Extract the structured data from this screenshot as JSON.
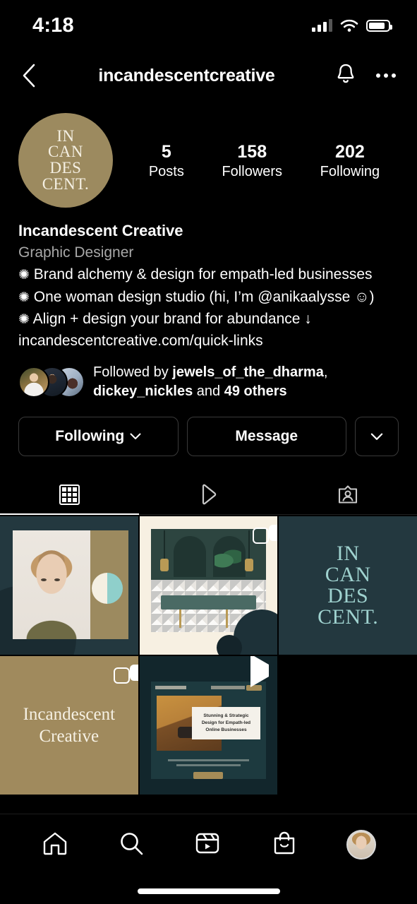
{
  "status_bar": {
    "time": "4:18",
    "signal_icon": "cellular-signal-icon",
    "wifi_icon": "wifi-icon",
    "battery_icon": "battery-icon"
  },
  "header": {
    "back_icon": "chevron-left-icon",
    "title": "incandescentcreative",
    "notify_icon": "bell-icon",
    "more_icon": "ellipsis-icon"
  },
  "profile": {
    "avatar": {
      "name": "profile-avatar",
      "logo_lines": [
        "IN",
        "CAN",
        "DES",
        "CENT."
      ],
      "bg_color": "#9c8a5f",
      "text_color": "#f4efe2"
    },
    "stats": [
      {
        "num": "5",
        "label": "Posts"
      },
      {
        "num": "158",
        "label": "Followers"
      },
      {
        "num": "202",
        "label": "Following"
      }
    ],
    "display_name": "Incandescent Creative",
    "category": "Graphic Designer",
    "bio_lines": [
      {
        "bullet": "✺",
        "text": " Brand alchemy & design for empath-led businesses"
      },
      {
        "bullet": "✺",
        "text": " One woman design studio (hi, I’m @anikaalysse ☺)"
      },
      {
        "bullet": "✺",
        "text": " Align + design your brand for abundance ↓"
      }
    ],
    "link": "incandescentcreative.com/quick-links",
    "followed_by": {
      "prefix": "Followed by ",
      "user1": "jewels_of_the_dharma",
      "separator": ", ",
      "user2": "dickey_nickles",
      "middle": " and ",
      "others": "49 others"
    }
  },
  "actions": {
    "following_label": "Following",
    "message_label": "Message",
    "more_icon": "chevron-down-icon",
    "following_chevron_icon": "chevron-down-icon"
  },
  "tabs": [
    {
      "name": "grid",
      "icon": "grid-icon",
      "active": true
    },
    {
      "name": "reels",
      "icon": "play-triangle-icon",
      "active": false
    },
    {
      "name": "tagged",
      "icon": "tagged-person-icon",
      "active": false
    }
  ],
  "grid": {
    "posts": [
      {
        "name": "post-portrait-headshot",
        "badge": "none",
        "alt": "Portrait headshot on teal background with gold band"
      },
      {
        "name": "post-bathroom-interior",
        "badge": "carousel",
        "alt": "Bathroom interior with arched mirrors and geometric tile"
      },
      {
        "name": "post-incandescent-logo",
        "badge": "none",
        "alt": "Incandescent logo card",
        "logo_lines": [
          "IN",
          "CAN",
          "DES",
          "CENT."
        ]
      },
      {
        "name": "post-incandescent-wordmark",
        "badge": "carousel",
        "alt": "Gold wordmark card",
        "wordmark_lines": [
          "Incandescent",
          "Creative"
        ]
      },
      {
        "name": "post-website-reel",
        "badge": "reel",
        "alt": "Reel showing website design",
        "headline": "Stunning & Strategic Design for Empath-led Online Businesses"
      }
    ]
  },
  "bottom_nav": [
    {
      "name": "home",
      "icon": "home-icon"
    },
    {
      "name": "search",
      "icon": "search-icon"
    },
    {
      "name": "reels",
      "icon": "reels-icon"
    },
    {
      "name": "shop",
      "icon": "shopping-bag-icon"
    },
    {
      "name": "profile",
      "icon": "profile-avatar-icon"
    }
  ],
  "colors": {
    "background": "#000000",
    "gold": "#9c8a5f",
    "teal": "#23383f",
    "cream": "#f7f0e2",
    "muted_text": "#a8a8a8",
    "border": "#3a3a3a"
  }
}
